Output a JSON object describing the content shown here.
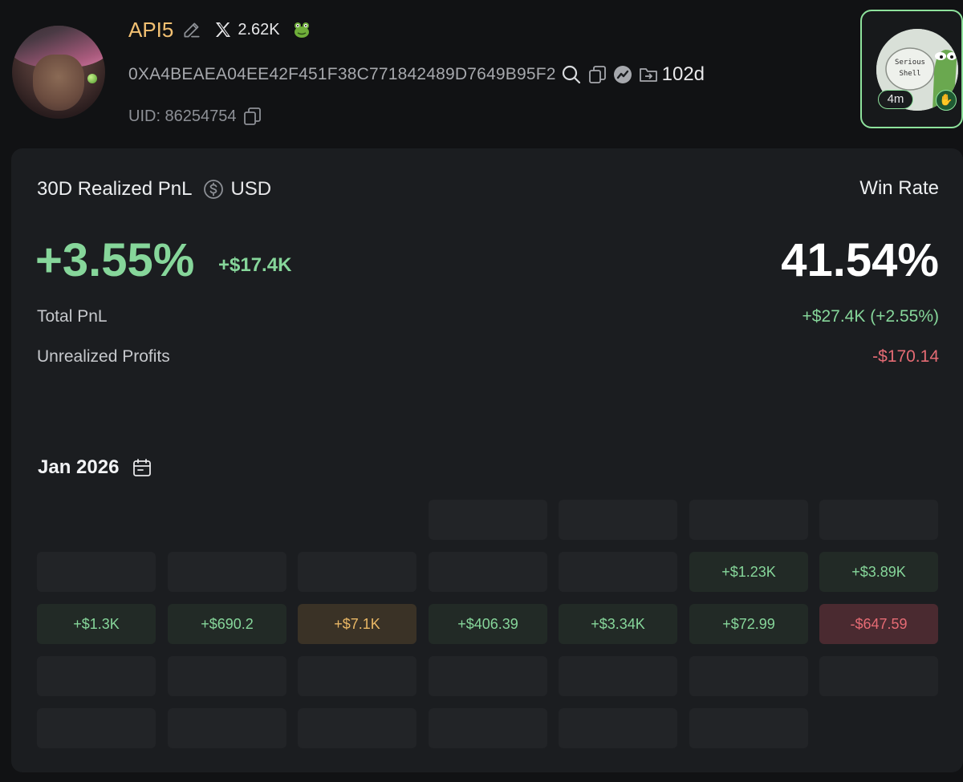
{
  "profile": {
    "name": "API5",
    "followers": "2.62K",
    "address": "0XA4BEAEA04EE42F451F38C771842489D7649B95F2",
    "age": "102d",
    "uid": "UID: 86254754",
    "badge_time": "4m",
    "badge_text_line1": "Serious",
    "badge_text_line2": "Shell"
  },
  "pnl": {
    "title": "30D Realized PnL",
    "currency": "USD",
    "percent": "+3.55%",
    "usd": "+$17.4K",
    "win_rate_label": "Win Rate",
    "win_rate": "41.54%",
    "total_pnl_label": "Total PnL",
    "total_pnl": "+$27.4K (+2.55%)",
    "unrealized_label": "Unrealized Profits",
    "unrealized": "-$170.14"
  },
  "calendar": {
    "month": "Jan 2026",
    "weeks": [
      [
        null,
        null,
        null,
        "",
        "",
        "",
        ""
      ],
      [
        "",
        "",
        "",
        "",
        "",
        "+$1.23K",
        "+$3.89K"
      ],
      [
        "+$1.3K",
        "+$690.2",
        "+$7.1K",
        "+$406.39",
        "+$3.34K",
        "+$72.99",
        "-$647.59"
      ],
      [
        "",
        "",
        "",
        "",
        "",
        "",
        ""
      ],
      [
        "",
        "",
        "",
        "",
        "",
        "",
        null
      ]
    ]
  },
  "colors": {
    "accent_green": "#86d69a",
    "accent_red": "#e56b74",
    "accent_gold": "#e9b765",
    "name_gold": "#f2c072"
  }
}
